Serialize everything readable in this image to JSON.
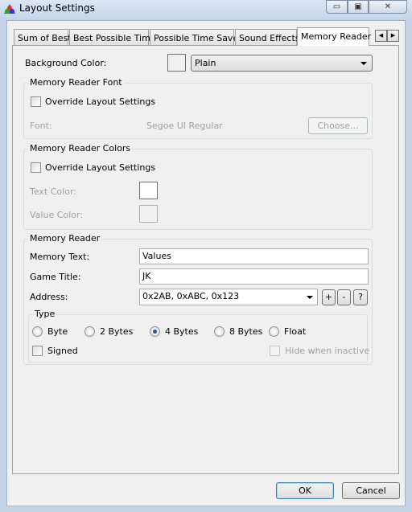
{
  "window": {
    "title": "Layout Settings",
    "controls": [
      "minimize",
      "maximize",
      "close"
    ]
  },
  "tabs": [
    {
      "label": "Sum of Best",
      "selected": false
    },
    {
      "label": "Best Possible Time",
      "selected": false
    },
    {
      "label": "Possible Time Save",
      "selected": false
    },
    {
      "label": "Sound Effects",
      "selected": false
    },
    {
      "label": "Memory Reader",
      "selected": true
    }
  ],
  "background": {
    "label": "Background Color:",
    "color": "#f0f0f0",
    "style": "Plain"
  },
  "font_group": {
    "title": "Memory Reader Font",
    "override_label": "Override Layout Settings",
    "override_checked": false,
    "font_label": "Font:",
    "font_value": "Segoe UI Regular",
    "choose_label": "Choose..."
  },
  "colors_group": {
    "title": "Memory Reader Colors",
    "override_label": "Override Layout Settings",
    "override_checked": false,
    "text_color_label": "Text Color:",
    "text_color": "#ffffff",
    "value_color_label": "Value Color:",
    "value_color": "#f0f0f0"
  },
  "reader_group": {
    "title": "Memory Reader",
    "memory_text_label": "Memory Text:",
    "memory_text": "Values",
    "game_title_label": "Game Title:",
    "game_title": "JK",
    "address_label": "Address:",
    "address": "0x2AB, 0xABC, 0x123",
    "add_label": "+",
    "remove_label": "-",
    "help_label": "?",
    "type": {
      "title": "Type",
      "options": [
        "Byte",
        "2 Bytes",
        "4 Bytes",
        "8 Bytes",
        "Float"
      ],
      "selected": "4 Bytes"
    },
    "signed_label": "Signed",
    "signed_checked": false,
    "hide_label": "Hide when inactive",
    "hide_checked": false
  },
  "buttons": {
    "ok": "OK",
    "cancel": "Cancel"
  }
}
